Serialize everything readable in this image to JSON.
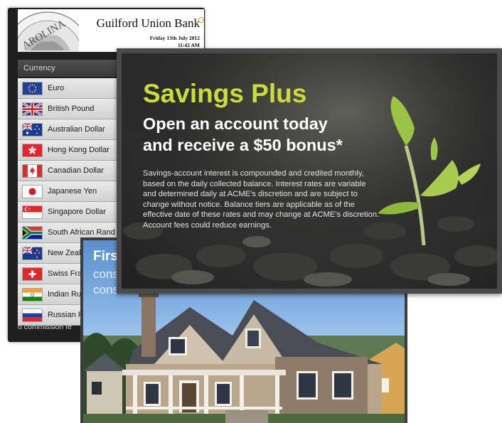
{
  "bank": {
    "name": "Guilford Union Bank",
    "date": "Friday 13th July 2012",
    "time": "11:42 AM",
    "seal_text": "AROLINA"
  },
  "currency_board": {
    "column_header": "Currency",
    "rows": [
      {
        "label": "Euro",
        "flag": "eu-flag-icon"
      },
      {
        "label": "British Pound",
        "flag": "uk-flag-icon"
      },
      {
        "label": "Australian Dollar",
        "flag": "australia-flag-icon"
      },
      {
        "label": "Hong Kong Dollar",
        "flag": "hong-kong-flag-icon"
      },
      {
        "label": "Canadian Dollar",
        "flag": "canada-flag-icon"
      },
      {
        "label": "Japanese Yen",
        "flag": "japan-flag-icon"
      },
      {
        "label": "Singapore Dollar",
        "flag": "singapore-flag-icon"
      },
      {
        "label": "South African Rand",
        "flag": "south-africa-flag-icon"
      },
      {
        "label": "New Zeala",
        "flag": "new-zealand-flag-icon"
      },
      {
        "label": "Swiss Fra",
        "flag": "switzerland-flag-icon"
      },
      {
        "label": "Indian Ru",
        "flag": "india-flag-icon"
      },
      {
        "label": "Russian R",
        "flag": "russia-flag-icon"
      }
    ],
    "footer": "o commission fe"
  },
  "house_promo": {
    "title": "Firs",
    "line1": "cons",
    "line2": "cons"
  },
  "savings_promo": {
    "title": "Savings Plus",
    "subtitle_line1": "Open an account today",
    "subtitle_line2": "and receive a $50 bonus*",
    "body": "Savings-account interest is compounded and credited monthly, based on the daily collected balance. Interest rates are variable and determined daily at ACME's discretion and are subject to change without notice. Balance tiers are applicable as of the effective date of these rates and may change at ACME's discretion. Account fees could reduce earnings.",
    "title_color": "#c8dc3a"
  }
}
